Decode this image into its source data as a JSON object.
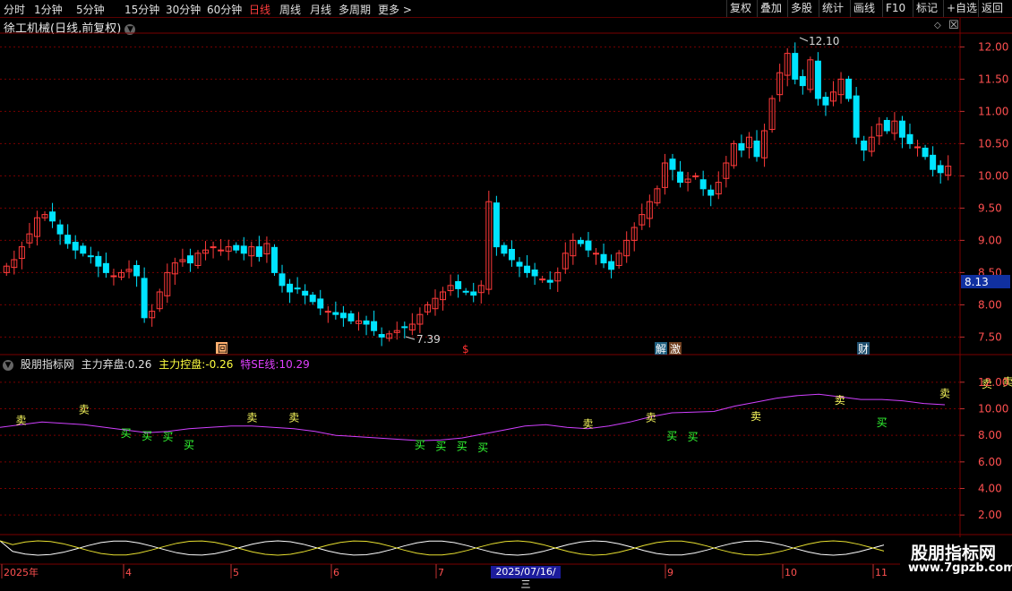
{
  "toolbar": {
    "periods": [
      "分时",
      "1分钟",
      "5分钟",
      "15分钟",
      "30分钟",
      "60分钟",
      "日线",
      "周线",
      "月线",
      "多周期",
      "更多 >"
    ],
    "active_period": "日线",
    "buttons": [
      "复权",
      "叠加",
      "多股",
      "统计",
      "画线",
      "F10",
      "标记",
      "+自选",
      "返回"
    ]
  },
  "stock": {
    "title": "徐工机械(日线,前复权)"
  },
  "price_panel": {
    "axis_labels": [
      "12.00",
      "11.50",
      "11.00",
      "10.50",
      "10.00",
      "9.50",
      "9.00",
      "8.50",
      "8.00",
      "7.50"
    ],
    "current_price": "8.13",
    "high_label": "12.10",
    "low_label": "7.39",
    "event_markers": [
      "回",
      "$",
      "解",
      "激",
      "财"
    ]
  },
  "indicator": {
    "name": "股朋指标网",
    "abandon_label": "主力弃盘:",
    "abandon_value": "0.26",
    "control_label": "主力控盘:",
    "control_value": "-0.26",
    "se_label": "特SE线:",
    "se_value": "10.29",
    "axis_labels": [
      "12.00",
      "10.00",
      "8.00",
      "6.00",
      "4.00",
      "2.00"
    ],
    "buy_text": "买",
    "sell_text": "卖"
  },
  "date_axis": {
    "labels": [
      "2025年",
      "4",
      "5",
      "6",
      "7",
      "9",
      "10",
      "11"
    ],
    "cursor_date": "2025/07/16/三"
  },
  "watermark": {
    "title": "股朋指标网",
    "url": "www.7gpzb.com"
  },
  "colors": {
    "up": "#ff3a3a",
    "down": "#00e4ff",
    "se_line": "#d040ff",
    "buy": "#33ff33",
    "sell": "#ffff60",
    "grid": "#7a0000"
  },
  "chart_data": {
    "type": "candlestick",
    "title": "徐工机械(日线,前复权)",
    "ylim": [
      7.2,
      12.2
    ],
    "price_high": 12.1,
    "price_low": 7.39,
    "last_price": 8.13,
    "close_series": [
      8.6,
      8.7,
      8.9,
      9.1,
      9.35,
      9.4,
      9.3,
      9.1,
      8.95,
      8.85,
      8.8,
      8.75,
      8.6,
      8.5,
      8.45,
      8.5,
      8.55,
      8.45,
      7.8,
      7.9,
      8.2,
      8.5,
      8.65,
      8.7,
      8.65,
      8.8,
      8.85,
      8.9,
      8.85,
      8.9,
      8.85,
      8.8,
      8.9,
      8.75,
      8.95,
      8.5,
      8.3,
      8.2,
      8.25,
      8.15,
      8.05,
      7.95,
      7.9,
      7.85,
      7.8,
      7.75,
      7.75,
      7.7,
      7.6,
      7.5,
      7.55,
      7.6,
      7.65,
      7.7,
      7.85,
      8.0,
      8.1,
      8.2,
      8.3,
      8.25,
      8.2,
      8.15,
      8.3,
      9.6,
      8.9,
      8.8,
      8.7,
      8.6,
      8.5,
      8.45,
      8.4,
      8.35,
      8.5,
      8.8,
      9.0,
      8.95,
      8.85,
      8.8,
      8.65,
      8.55,
      8.8,
      9.0,
      9.2,
      9.4,
      9.6,
      9.8,
      10.2,
      10.1,
      9.9,
      9.95,
      10.0,
      9.8,
      9.7,
      9.9,
      10.2,
      10.5,
      10.4,
      10.6,
      10.3,
      10.7,
      11.2,
      11.6,
      11.9,
      11.5,
      11.4,
      11.8,
      11.2,
      11.1,
      11.3,
      11.5,
      11.2,
      10.6,
      10.4,
      10.6,
      10.8,
      10.7,
      10.85,
      10.6,
      10.5,
      10.45,
      10.3,
      10.1,
      10.05,
      10.15
    ],
    "indicator_ylim": [
      1.0,
      13.0
    ],
    "se_line": [
      8.6,
      8.8,
      9.0,
      8.9,
      8.8,
      8.6,
      8.4,
      8.2,
      8.3,
      8.5,
      8.6,
      8.7,
      8.7,
      8.6,
      8.5,
      8.3,
      8.0,
      7.9,
      7.8,
      7.7,
      7.6,
      7.65,
      7.8,
      8.1,
      8.4,
      8.7,
      8.8,
      8.6,
      8.5,
      8.7,
      9.0,
      9.4,
      9.7,
      9.75,
      9.8,
      10.2,
      10.5,
      10.8,
      11.0,
      11.1,
      10.9,
      10.7,
      10.7,
      10.6,
      10.4,
      10.3
    ],
    "signals": [
      {
        "type": "sell",
        "x": 1,
        "y": 8.6
      },
      {
        "type": "sell",
        "x": 4,
        "y": 9.4
      },
      {
        "type": "buy",
        "x": 6,
        "y": 8.7
      },
      {
        "type": "buy",
        "x": 7,
        "y": 8.5
      },
      {
        "type": "buy",
        "x": 8,
        "y": 8.4
      },
      {
        "type": "buy",
        "x": 9,
        "y": 7.8
      },
      {
        "type": "sell",
        "x": 12,
        "y": 8.8
      },
      {
        "type": "sell",
        "x": 14,
        "y": 8.8
      },
      {
        "type": "buy",
        "x": 20,
        "y": 7.8
      },
      {
        "type": "buy",
        "x": 21,
        "y": 7.7
      },
      {
        "type": "buy",
        "x": 22,
        "y": 7.7
      },
      {
        "type": "buy",
        "x": 23,
        "y": 7.6
      },
      {
        "type": "sell",
        "x": 28,
        "y": 8.3
      },
      {
        "type": "sell",
        "x": 31,
        "y": 8.8
      },
      {
        "type": "buy",
        "x": 32,
        "y": 8.5
      },
      {
        "type": "buy",
        "x": 33,
        "y": 8.4
      },
      {
        "type": "sell",
        "x": 36,
        "y": 8.9
      },
      {
        "type": "sell",
        "x": 40,
        "y": 10.1
      },
      {
        "type": "buy",
        "x": 42,
        "y": 9.5
      },
      {
        "type": "sell",
        "x": 45,
        "y": 10.6
      },
      {
        "type": "sell",
        "x": 47,
        "y": 11.3
      },
      {
        "type": "sell",
        "x": 48,
        "y": 11.5
      },
      {
        "type": "buy",
        "x": 51,
        "y": 10.4
      },
      {
        "type": "buy",
        "x": 55,
        "y": 10.0
      }
    ]
  }
}
